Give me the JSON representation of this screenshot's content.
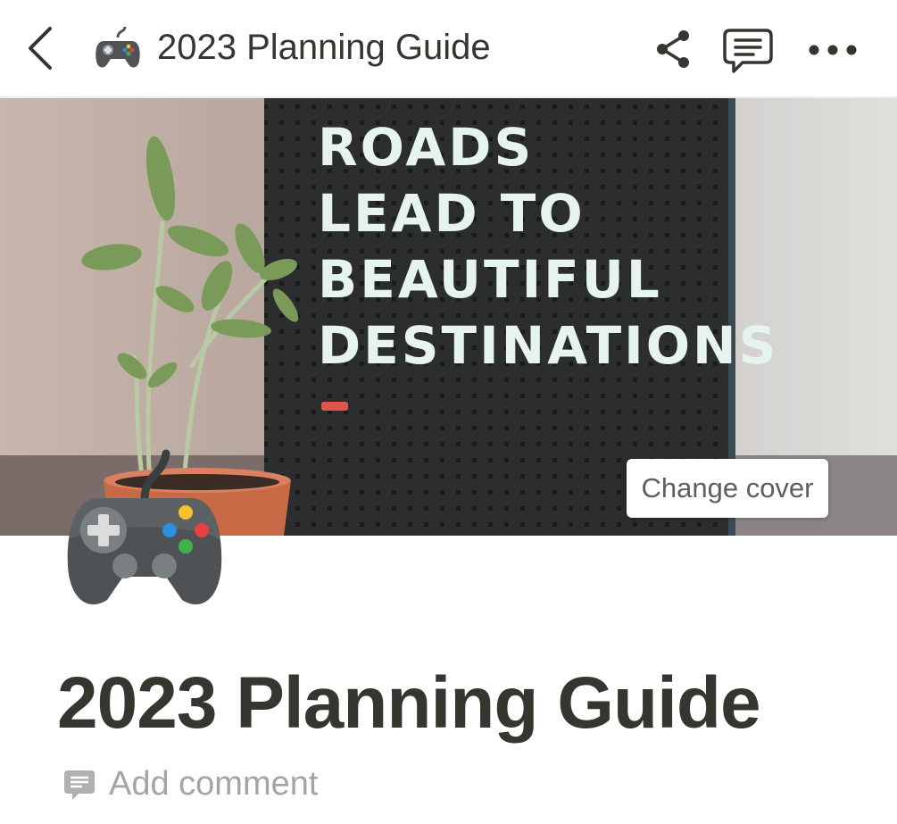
{
  "topbar": {
    "title": "2023 Planning Guide",
    "back_icon": "chevron-left-icon",
    "emoji_icon": "video-game-controller-icon",
    "share_icon": "share-icon",
    "comment_icon": "comment-icon",
    "more_icon": "more-horizontal-icon"
  },
  "cover": {
    "lines": [
      "ROADS",
      "LEAD TO",
      "BEAUTIFUL",
      "DESTINATIONS"
    ],
    "change_label": "Change cover"
  },
  "page": {
    "icon": "video-game-controller-icon",
    "title": "2023 Planning Guide",
    "add_comment_label": "Add comment"
  }
}
